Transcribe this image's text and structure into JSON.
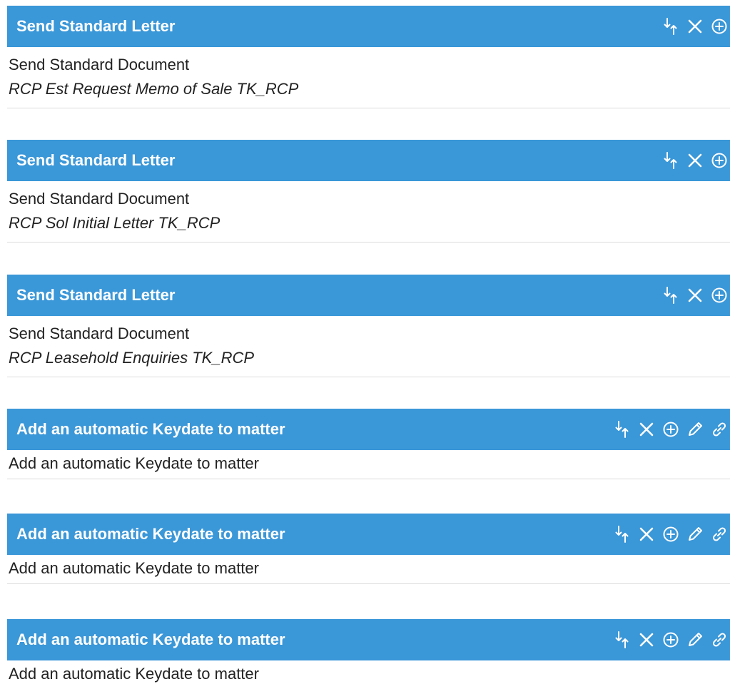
{
  "colors": {
    "header_bg": "#3a97d8",
    "header_text": "#ffffff"
  },
  "actions": [
    {
      "title": "Send Standard Letter",
      "line1": "Send Standard Document",
      "line2": "RCP Est Request Memo of Sale TK_RCP",
      "icons": [
        "reorder-icon",
        "close-icon",
        "add-circle-icon"
      ]
    },
    {
      "title": "Send Standard Letter",
      "line1": "Send Standard Document",
      "line2": "RCP Sol Initial Letter TK_RCP",
      "icons": [
        "reorder-icon",
        "close-icon",
        "add-circle-icon"
      ]
    },
    {
      "title": "Send Standard Letter",
      "line1": "Send Standard Document",
      "line2": "RCP Leasehold Enquiries TK_RCP",
      "icons": [
        "reorder-icon",
        "close-icon",
        "add-circle-icon"
      ]
    },
    {
      "title": "Add an automatic Keydate to matter",
      "line1": "Add an automatic Keydate to matter",
      "icons": [
        "reorder-icon",
        "close-icon",
        "add-circle-icon",
        "pencil-icon",
        "link-icon"
      ]
    },
    {
      "title": "Add an automatic Keydate to matter",
      "line1": "Add an automatic Keydate to matter",
      "icons": [
        "reorder-icon",
        "close-icon",
        "add-circle-icon",
        "pencil-icon",
        "link-icon"
      ]
    },
    {
      "title": "Add an automatic Keydate to matter",
      "line1": "Add an automatic Keydate to matter",
      "icons": [
        "reorder-icon",
        "close-icon",
        "add-circle-icon",
        "pencil-icon",
        "link-icon"
      ]
    }
  ]
}
